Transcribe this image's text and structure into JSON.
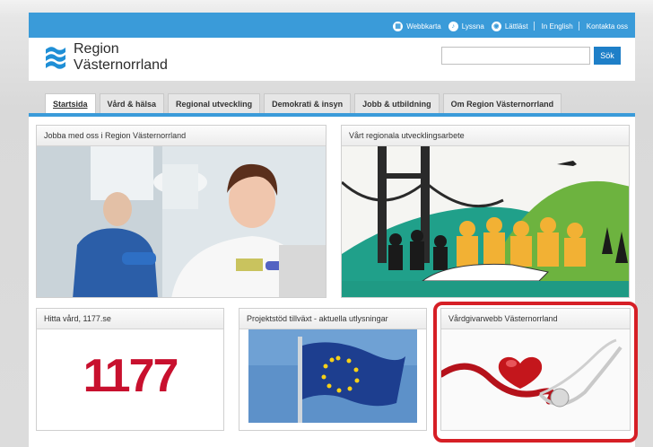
{
  "topbar": {
    "links": [
      {
        "icon": "sitemap-icon",
        "label": "Webbkarta"
      },
      {
        "icon": "listen-icon",
        "label": "Lyssna"
      },
      {
        "icon": "easy-read-icon",
        "label": "Lättläst"
      },
      {
        "icon": "",
        "label": "In English"
      },
      {
        "icon": "",
        "label": "Kontakta oss"
      }
    ]
  },
  "logo": {
    "line1": "Region",
    "line2": "Västernorrland"
  },
  "search": {
    "placeholder": "",
    "button_label": "Sök"
  },
  "nav": {
    "tabs": [
      {
        "label": "Startsida",
        "active": true
      },
      {
        "label": "Vård & hälsa"
      },
      {
        "label": "Regional utveckling"
      },
      {
        "label": "Demokrati & insyn"
      },
      {
        "label": "Jobb & utbildning"
      },
      {
        "label": "Om Region Västernorrland"
      }
    ]
  },
  "cards": {
    "jobs": {
      "title": "Jobba med oss i Region Västernorrland"
    },
    "development": {
      "title": "Vårt regionala utvecklingsarbete"
    },
    "care": {
      "title": "Hitta vård, 1177.se",
      "logo_text": "1177"
    },
    "projects": {
      "title": "Projektstöd tillväxt - aktuella utlysningar"
    },
    "caregiver": {
      "title": "Vårdgivarwebb Västernorrland"
    }
  },
  "colors": {
    "brand_blue": "#3a9bd9",
    "highlight_red": "#d61f26",
    "logo_1177": "#c8102e"
  }
}
